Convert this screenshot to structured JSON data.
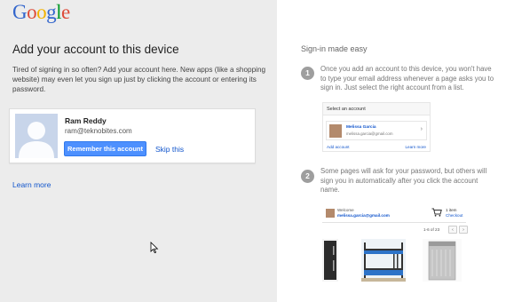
{
  "logo": {
    "letters": [
      "G",
      "o",
      "o",
      "g",
      "l",
      "e"
    ],
    "colors": [
      "#3366cc",
      "#dd4b39",
      "#f2b100",
      "#3366cc",
      "#009925",
      "#dd4b39"
    ]
  },
  "left": {
    "title": "Add your account to this device",
    "description": "Tired of signing in so often? Add your account here. New apps (like a shopping website) may even let you sign up just by clicking the account or entering its password.",
    "account": {
      "name": "Ram Reddy",
      "email": "ram@teknobites.com"
    },
    "remember_button": "Remember this account",
    "skip_link": "Skip this",
    "learn_more": "Learn more"
  },
  "right": {
    "title": "Sign-in made easy",
    "steps": [
      {
        "number": "1",
        "text": "Once you add an account to this device, you won't have to type your email address whenever a page asks you to sign in. Just select the right account from a list."
      },
      {
        "number": "2",
        "text": "Some pages will ask for your password, but others will sign you in automatically after you click the account name."
      }
    ],
    "mock_select": {
      "heading": "Select an account",
      "name": "Melissa Garcia",
      "email": "melissa.garcia@gmail.com",
      "add_link": "Add account",
      "learn_link": "Learn more"
    },
    "mock_shop": {
      "welcome": "Welcome",
      "email": "melissa.garcia@gmail.com",
      "cart_count": "1 item",
      "checkout": "Checkout",
      "pager": "1-6 of 23",
      "prev": "‹",
      "next": "›"
    }
  },
  "colors": {
    "accent": "#4d90fe",
    "link": "#1155cc",
    "left_bg": "#ececec"
  }
}
